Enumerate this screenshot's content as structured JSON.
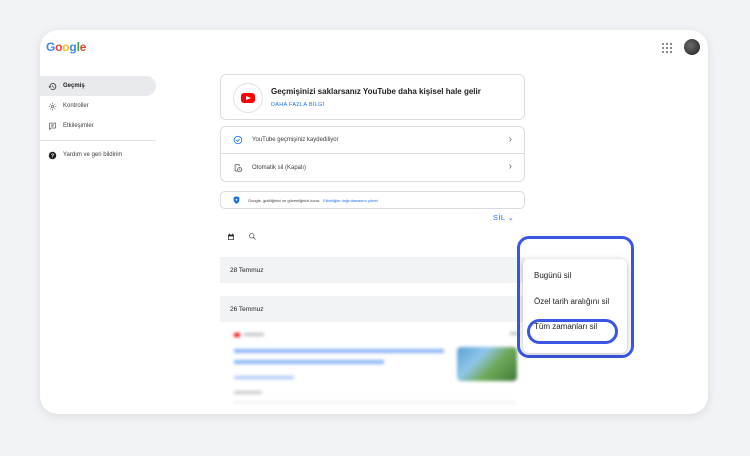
{
  "brand": {
    "logo": "Google"
  },
  "header": {
    "apps_icon": "apps-grid-icon",
    "avatar_icon": "account-avatar"
  },
  "sidebar": {
    "items": [
      {
        "label": "Geçmiş",
        "icon": "history-icon",
        "active": true
      },
      {
        "label": "Kontroller",
        "icon": "gear-icon"
      },
      {
        "label": "Etkileşimler",
        "icon": "comment-icon"
      },
      {
        "label": "Yardım ve geri bildirim",
        "icon": "help-icon"
      }
    ]
  },
  "banner": {
    "title": "Geçmişinizi saklarsanız YouTube daha kişisel hale gelir",
    "link": "DAHA FAZLA BİLGİ",
    "icon": "youtube-icon"
  },
  "settings": {
    "history_status": "YouTube geçmişiniz kaydediliyor",
    "auto_delete": "Otomatik sil (Kapalı)"
  },
  "privacy": {
    "text": "Google, gizliliğinizi ve güvenliğinizi korur.",
    "link": "Etkinliğim doğrulamasını yönet"
  },
  "dates": [
    "28 Temmuz",
    "26 Temmuz"
  ],
  "delete": {
    "button": "SİL",
    "menu": [
      "Bugünü sil",
      "Özel tarih aralığını sil",
      "Tüm zamanları sil"
    ]
  },
  "colors": {
    "accent": "#1a73e8",
    "highlight": "#3b55e6",
    "youtube": "#ff0000"
  }
}
